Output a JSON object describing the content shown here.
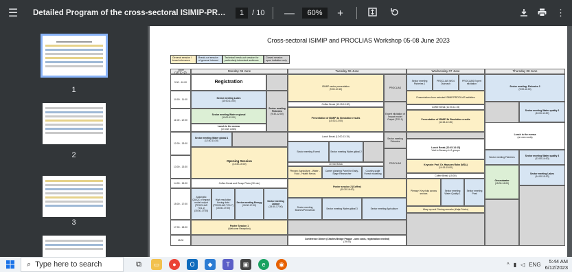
{
  "toolbar": {
    "title": "Detailed Program of the cross-sectoral ISIMIP-PROCLIAS work...",
    "page_current": "1",
    "page_total": "/ 10",
    "zoom_out": "—",
    "zoom": "60%",
    "zoom_in": "+"
  },
  "sidebar": {
    "thumbnails": [
      {
        "num": "1"
      },
      {
        "num": "2"
      },
      {
        "num": "3"
      }
    ]
  },
  "document": {
    "title": "Cross-sectoral ISIMIP and PROCLIAS Workshop 05-08 June 2023",
    "legend": [
      "General session / broad relevance",
      "Break-out session of general interest",
      "Technical break-out session for particularly interested audience",
      "Closed session upon invitation only"
    ],
    "headers": {
      "time": "Time (UTC+2)",
      "mon": "Monday 05 June",
      "tue": "Tuesday 06 June",
      "wed": "Wednesday 07 June",
      "thu": "Thursday 08 June"
    },
    "times": [
      "9:30 - 10:00",
      "10:00 - 11:00",
      "11:00 - 12:00",
      "12:00 - 13:00",
      "13:00 - 13:30",
      "14:00 - 15:00",
      "15:00 - 17:00",
      "17:00 - 18:00",
      "18:00"
    ],
    "mon": {
      "registration": "Registration",
      "lakes": "Sector meeting Lakes",
      "lakes_t": "(10:00-11:00)",
      "water_regional": "Sector meeting Water regional",
      "water_regional_t": "(11:00-12:00)",
      "fisheries": "Sector meeting Fisheries",
      "fisheries_t": "(9:30-12:00)",
      "lunch": "Lunch in the mensa",
      "lunch_sub": "(on own costs)",
      "water_global": "Sector meeting Water global 1",
      "water_global_t": "(12:30-13:30)",
      "opening": "Opening Session",
      "opening_t": "(13:30-15:00)",
      "coffee": "Coffee Break and Group Photo (30 min)",
      "automatic": "Automatic QA/QC of impact model output (PROCLIAS TG1.1)",
      "high_res": "High resolution forcing data (PROCLIAS TG1.7)",
      "energy": "Sector meeting Energy",
      "labour": "Sector meeting Labour",
      "times_s": "(15:30-17:00)",
      "poster": "Poster Session 1",
      "poster_sub": "(Welcome Reception)"
    },
    "tue": {
      "isimip": "ISIMIP sector presentation",
      "isimip_t": "(9:00-10:15)",
      "coffee1": "Coffee Break (10:15-10:30)",
      "presentation": "Presentation of ISIMIP 3a Simulation results",
      "presentation_t": "(10:30-12:00)",
      "lunch": "Lunch Break (12:00-13:15)",
      "fisheries": "Sector meeting Fisheries",
      "forest": "Sector meeting Forest",
      "water_global2": "Sector meeting Water global 2",
      "proclias": "PROCLIAS",
      "break10": "10 min Break",
      "plenary": "Plenary: Agriculture - Water - Food - Health Nexus",
      "career": "Career planning Panel for Early-Stage Researcher",
      "country": "Country-scale Forest modelling",
      "poster2": "Poster session 2 (Coffee)",
      "poster2_t": "(15:30-16:00)",
      "biomes": "Sector meeting Biomes/Permafrost",
      "water_global3": "Sector meeting Water global 3",
      "agriculture": "Sector meeting Agriculture",
      "dinner": "Conference Dinner (Charles Bridge Prague - own costs, registration needed)",
      "dinner_t": "(19:00)",
      "expert": "Expert elicitation of Impact model Output (TG1.1)"
    },
    "wed": {
      "fisheries": "Sector meeting Fisheries 1",
      "wg4": "PROCLIAS WG4 Outreach",
      "proclias_exp": "PROCLIAS Expert elicitation",
      "pres_from": "Presentations from selected ISIMIP/PROCLIAS activities",
      "coffee": "Coffee Break (11:00-11:15)",
      "pres3b": "Presentation of ISIMIP 3b Simulation results",
      "pres3b_t": "(11:15-12:45)",
      "lunch": "Lunch Break (12:45-14:15)",
      "lunch_sub": "Visit to Brewery in 2 groups",
      "keynote": "Keynote: Prof. Dr. Hayssen Rahn (MSA)",
      "keynote_t": "(14:15-15:00)",
      "coffee2": "Coffee Break (15:00)",
      "plenary": "Plenary: Key risks across sectors",
      "water_q1": "Sector meeting Water Quality 1",
      "peat": "Sector meeting Peat",
      "wrapup": "Wrap up and Closing remarks (Katja Frieler)"
    },
    "thu": {
      "fisheries2": "Sector meeting: Fisheries 2",
      "fisheries2_t": "(9:00-11:00)",
      "wq2": "Sector meeting Water quality 2",
      "wq2_t": "(10:00-11:30)",
      "lunch": "Lunch in the mensa",
      "lunch_sub": "(on own costs)",
      "wq3": "Sector meeting Water quality 3",
      "wq3_t": "(13:00-14:00)",
      "fisheries": "Sector meeting Fisheries",
      "lakes": "Sector meeting Lakes",
      "lakes_t": "(14:00-15:30)",
      "groundwater": "Groundwater",
      "groundwater_t": "(15:00-16:00)"
    }
  },
  "taskbar": {
    "search_placeholder": "Type here to search",
    "lang": "ENG",
    "time": "5:44 AM",
    "date": "6/12/2023"
  }
}
